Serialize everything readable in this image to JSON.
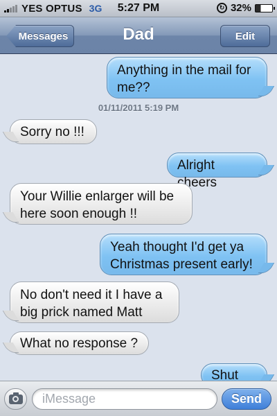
{
  "status_bar": {
    "carrier": "YES OPTUS",
    "network": "3G",
    "time": "5:27 PM",
    "battery": "32%",
    "battery_level": 0.32
  },
  "nav_bar": {
    "back_label": "Messages",
    "title": "Dad",
    "edit_label": "Edit"
  },
  "conversation": {
    "timestamp": "01/11/2011 5:19 PM",
    "messages": [
      {
        "direction": "sent",
        "lines": [
          "Anything in the mail for",
          "me??"
        ]
      },
      {
        "direction": "received",
        "lines": [
          "Sorry no !!!"
        ]
      },
      {
        "direction": "sent",
        "lines": [
          "Alright cheers"
        ]
      },
      {
        "direction": "received",
        "lines": [
          "Your Willie enlarger will be",
          "here soon enough !!"
        ]
      },
      {
        "direction": "sent",
        "lines": [
          "Yeah thought I'd get ya",
          "Christmas present early!"
        ]
      },
      {
        "direction": "received",
        "lines": [
          "No don't need it I have a",
          "big prick named Matt"
        ]
      },
      {
        "direction": "received",
        "lines": [
          "What no response ?"
        ]
      },
      {
        "direction": "sent",
        "lines": [
          "Shut up."
        ]
      }
    ]
  },
  "input_bar": {
    "placeholder": "iMessage",
    "send_label": "Send"
  },
  "colors": {
    "sent_bubble": "#7fc2f3",
    "received_bubble": "#eaeaea",
    "background": "#dbe2ed",
    "nav_bar": "#6d85a9"
  }
}
